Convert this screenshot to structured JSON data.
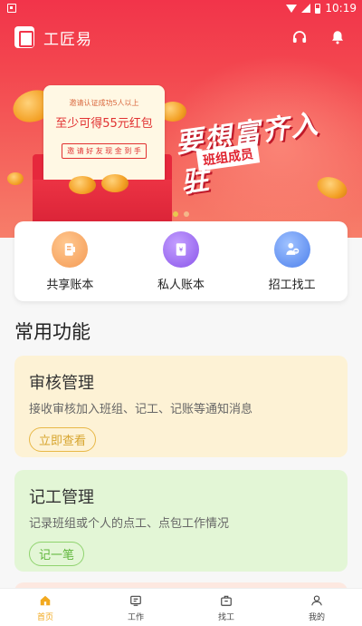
{
  "status_bar": {
    "time": "10:19"
  },
  "header": {
    "app_name": "工匠易"
  },
  "banner": {
    "letter_line1": "邀请认证成功5人以上",
    "letter_line2": "至少可得55元红包",
    "letter_button": "邀 请 好 友   现 金 到 手",
    "slogan_main": "要想富齐入驻",
    "slogan_sub": "班组成员",
    "active_slide": 1,
    "slide_count": 2
  },
  "quick_nav": [
    {
      "label": "共享账本",
      "icon": "ledger-icon",
      "color": "#f6a060"
    },
    {
      "label": "私人账本",
      "icon": "wallet-book-icon",
      "color": "#9a6bf0"
    },
    {
      "label": "招工找工",
      "icon": "worker-search-icon",
      "color": "#5b8ef0"
    }
  ],
  "section_title": "常用功能",
  "features": [
    {
      "title": "审核管理",
      "desc": "接收审核加入班组、记工、记账等通知消息",
      "button": "立即查看"
    },
    {
      "title": "记工管理",
      "desc": "记录班组或个人的点工、点包工作情况",
      "button": "记一笔"
    }
  ],
  "bottom_nav": [
    {
      "label": "首页",
      "icon": "home-icon",
      "active": true
    },
    {
      "label": "工作",
      "icon": "work-icon",
      "active": false
    },
    {
      "label": "找工",
      "icon": "find-job-icon",
      "active": false
    },
    {
      "label": "我的",
      "icon": "profile-icon",
      "active": false
    }
  ],
  "colors": {
    "brand_red": "#f2344a",
    "accent_orange": "#f2a91f"
  }
}
